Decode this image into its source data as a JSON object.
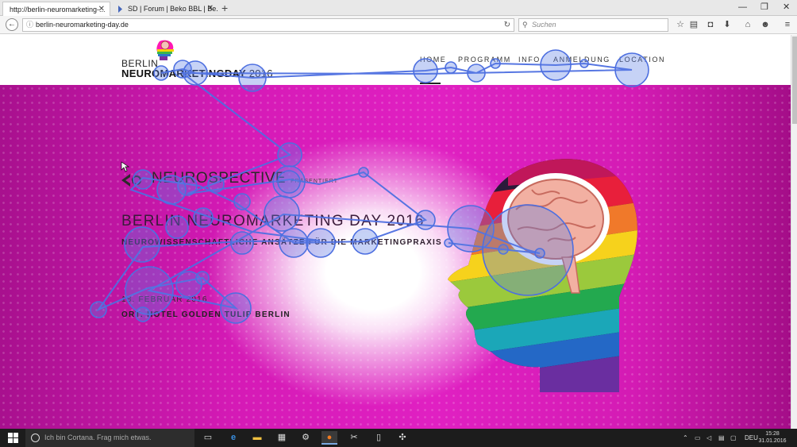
{
  "browser": {
    "tabs": [
      {
        "label": "http://berlin-neuromarketing-..."
      },
      {
        "label": "SD | Forum | Beko BBL | Be..."
      }
    ],
    "url": "berlin-neuromarketing-day.de",
    "search_placeholder": "Suchen",
    "icons": [
      "back-arrow-icon",
      "reload-icon",
      "bookmark-star-icon",
      "reader-icon",
      "pocket-icon",
      "download-icon",
      "home-icon",
      "chat-icon",
      "menu-icon"
    ]
  },
  "site": {
    "logo": {
      "city": "BERLIN",
      "name": "NEUROMARKETINGDAY",
      "year": "2016"
    },
    "nav": [
      "HOME",
      "PROGRAMM",
      "INFO",
      "ANMELDUNG",
      "LOCATION"
    ],
    "presenter": {
      "name": "NEUROSPECTIVE",
      "tagline": "PRÄSENTIERT"
    },
    "title": "BERLIN NEUROMARKETING DAY 2016",
    "subtitle": "NEUROWISSENSCHAFTLICHE ANSÄTZE FÜR DIE MARKETINGPRAXIS",
    "date": "18. FEBRUAR 2016",
    "venue": "ORT: HOTEL GOLDEN TULIP BERLIN"
  },
  "colors": {
    "hero_magenta": "#d51ab6",
    "gaze_blue": "#5b7fe6"
  },
  "taskbar": {
    "cortana_placeholder": "Ich bin Cortana. Frag mich etwas.",
    "language": "DEU",
    "time": "15:28",
    "date": "31.01.2016"
  }
}
